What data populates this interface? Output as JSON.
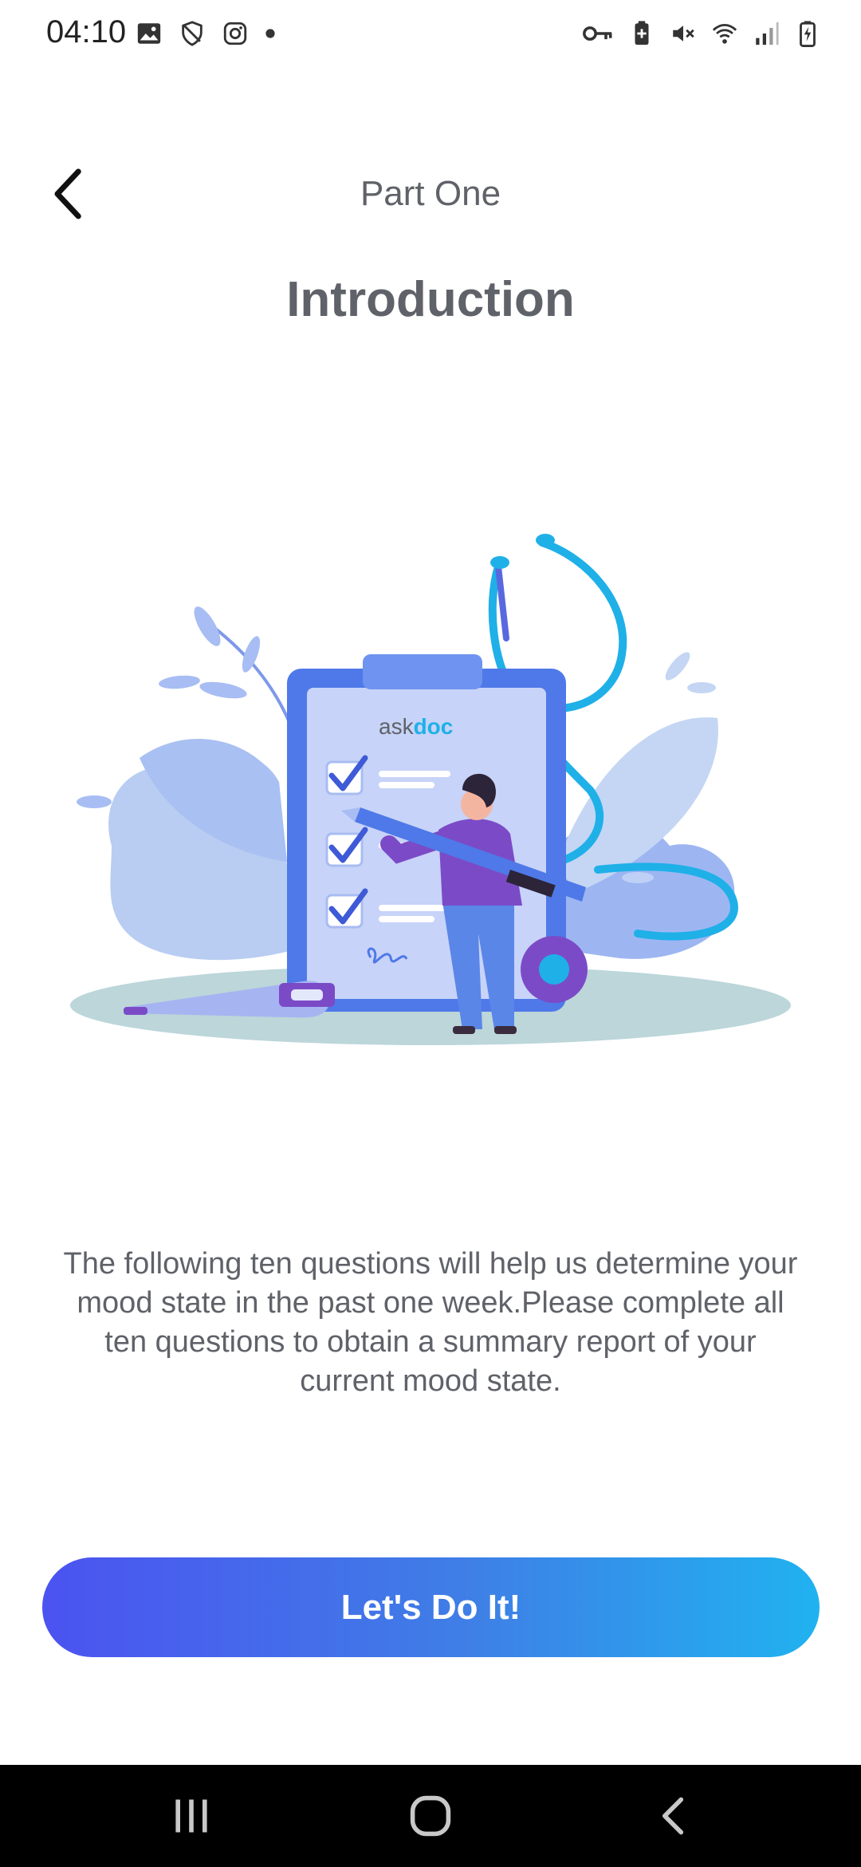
{
  "status_bar": {
    "time": "04:10",
    "left_icons": [
      "image-icon",
      "shield-icon",
      "instagram-icon",
      "dot-icon"
    ],
    "right_icons": [
      "key-icon",
      "battery-saver-icon",
      "mute-icon",
      "wifi-icon",
      "signal-icon",
      "battery-charging-icon"
    ]
  },
  "header": {
    "back_icon": "chevron-left-icon",
    "title": "Part One"
  },
  "page": {
    "title": "Introduction",
    "illustration": {
      "brand_text_prefix": "ask",
      "brand_text_suffix": "doc"
    },
    "description": "The following ten questions will help us determine your mood state in the past one week.Please complete all ten questions to obtain a summary report of your current mood state."
  },
  "cta": {
    "label": "Let's Do It!"
  },
  "nav_bar": {
    "buttons": [
      "recent-apps-icon",
      "home-icon",
      "back-icon"
    ]
  },
  "colors": {
    "text": "#5f6268",
    "cta_start": "#4b53f0",
    "cta_end": "#20b2f0",
    "accent_blue": "#4f79e8",
    "accent_purple": "#7b4bc7",
    "accent_cyan": "#1fb0e8"
  }
}
